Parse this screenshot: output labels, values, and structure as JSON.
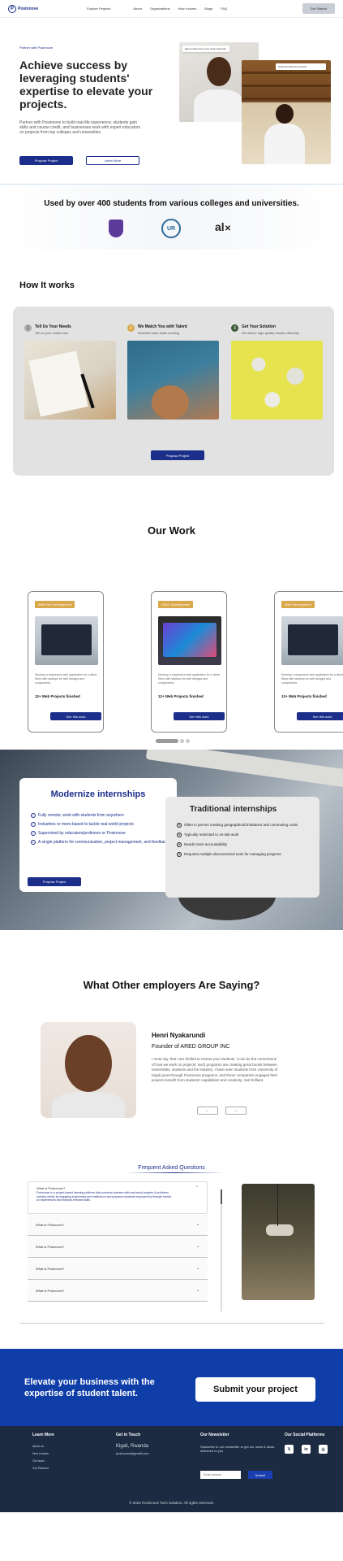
{
  "nav": {
    "logo": "Posinnove",
    "links": [
      "Explore Projects",
      "About",
      "Organizations",
      "How it works",
      "Blogs",
      "FAQ"
    ],
    "cta": "Get Started"
  },
  "hero": {
    "kicker": "Partner with Posinnove",
    "title": "Achieve success by leveraging students' expertise to elevate your projects.",
    "subtitle": "Partner with Posinnove to build real-life experience; students gain skills and course credit, and businesses work with expert educators on projects from top colleges and universities.",
    "primary_button": "Propose Project",
    "secondary_button": "Learn More",
    "card_tag_1": "Expert talent from your local university",
    "card_tag_2": "Students delivering results"
  },
  "used_by": {
    "title": "Used by over 400 students from various colleges and universities.",
    "logos": [
      "university-crest",
      "UR",
      "alx"
    ]
  },
  "how": {
    "title": "How It works",
    "steps": [
      {
        "num": "1",
        "title": "Tell Us Your Needs",
        "desc": "Tell us your needs here",
        "color": "#aaaaaa"
      },
      {
        "num": "2",
        "title": "We Match You with Talent",
        "desc": "Matched team starts working",
        "color": "#d9a84a"
      },
      {
        "num": "3",
        "title": "Get Your Solution",
        "desc": "We deliver high-quality results efficiently",
        "color": "#3c5a3a"
      }
    ],
    "button": "Propose Project"
  },
  "work": {
    "title": "Our Work",
    "cards": [
      {
        "tag": "Web Dev Development",
        "desc": "Develop a responsive web application for a client. Work with startups for web designs and components.",
        "stat": "12+ Web Projects finished",
        "button": "See this work"
      },
      {
        "tag": "UI/UX Development",
        "desc": "Develop a responsive web application for a client. Work with startups for web designs and components.",
        "stat": "12+ Web Projects finished",
        "button": "See this work"
      },
      {
        "tag": "Web Development",
        "desc": "Develop a responsive web application for a client. Work with startups for web designs and components.",
        "stat": "12+ Web Projects finished",
        "button": "See this work"
      }
    ]
  },
  "intern": {
    "modern_title": "Modernize internships",
    "modern_items": [
      "Fully remote; work with students from anywhere",
      "Industries or more-based to tackle real-world projects",
      "Supervised by educators/professor or Posinnove",
      "A single platform for communication, project management, and feedback"
    ],
    "modern_button": "Propose Project",
    "trad_title": "Traditional internships",
    "trad_items": [
      "Often in person creating geographical limitations and commuting costs",
      "Typically restricted to on-site work",
      "Needs more accountability",
      "Requires multiple disconnected tools for managing progress"
    ]
  },
  "testimonial": {
    "title": "What Other employers Are Saying?",
    "name": "Henri Nyakarundi",
    "role": "Founder of ARED GROUP INC",
    "quote": "I must say, that I am thrilled to review your students, it can be the cornerstone of how we work on projects; such programs are creating great bonds between universities, students and the industry. I have seen students from University of Kigali grow through Posinnove programs, and these companies engaged their projects benefit from students' capabilities and creativity. Just brilliant.",
    "prev": "←",
    "next": "→"
  },
  "faq": {
    "title": "Frequent Asked Questions",
    "items": [
      {
        "q": "What is Posinnove?",
        "a": "Posinnove is a project-based learning platform that connects learners with real-world projects & problems industry needs by engaging businesses and institutions and prepares students employed by through hands-on experiences and industry-relevant skills.",
        "open": true
      },
      {
        "q": "What is Posinnove?",
        "a": "",
        "open": false
      },
      {
        "q": "What is Posinnove?",
        "a": "",
        "open": false
      },
      {
        "q": "What is Posinnove?",
        "a": "",
        "open": false
      },
      {
        "q": "What is Posinnove?",
        "a": "",
        "open": false
      }
    ]
  },
  "cta": {
    "text": "Elevate your business with the expertise of student talent.",
    "button": "Submit your project"
  },
  "footer": {
    "learn_more_title": "Learn More",
    "learn_more_links": [
      "About us",
      "How it works",
      "Our team",
      "Our Partners"
    ],
    "contact_title": "Get in Touch",
    "contact_city": "Kigali, Rwanda",
    "contact_email": "posinnove@gmail.com",
    "newsletter_title": "Our Newsletter",
    "newsletter_text": "Subscribe to our newsletter to get our news & deals delivered to you",
    "newsletter_placeholder": "Email address",
    "newsletter_button": "Submit",
    "social_title": "Our Social Platforms",
    "social_icons": [
      "x-icon",
      "linkedin-icon",
      "instagram-icon"
    ],
    "copyright": "© 2024 Posinnove Tech Solution. All rights reserved."
  }
}
